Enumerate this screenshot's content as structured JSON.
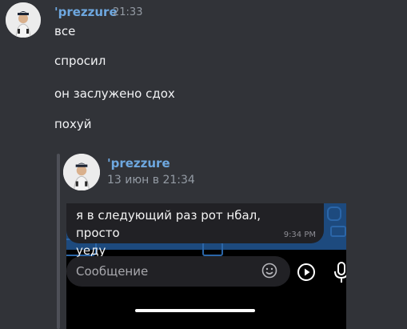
{
  "main_message": {
    "username": "'prezzure",
    "timestamp": "21:33",
    "lines": [
      "все",
      "спросил",
      "он заслужено сдох",
      "похуй"
    ]
  },
  "forwarded": {
    "username": "'prezzure",
    "timestamp": "13 июн в 21:34",
    "screenshot": {
      "bubble_text": "я в следующий раз рот нбал, просто\nуеду",
      "bubble_time": "9:34 PM",
      "input_placeholder": "Сообщение",
      "icons": [
        "emoji-icon",
        "play-icon",
        "mic-icon"
      ]
    }
  },
  "colors": {
    "background": "#313338",
    "username": "#6ea8e0",
    "timestamp": "#949ba4"
  }
}
